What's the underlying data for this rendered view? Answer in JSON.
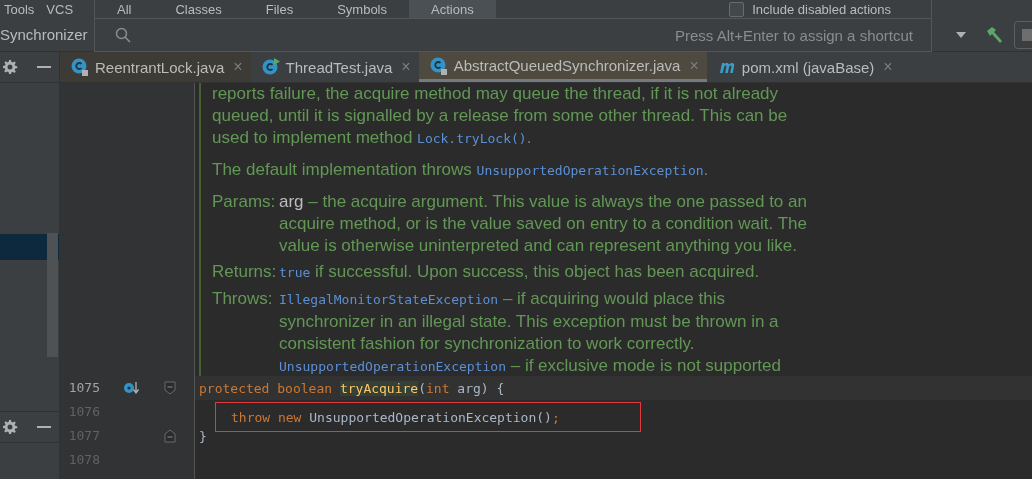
{
  "menu_bar": {
    "items": [
      "Tools",
      "VCS"
    ]
  },
  "navigation_bar": {
    "breadcrumbs": [
      "Synchronizer"
    ]
  },
  "search_popup": {
    "tabs": [
      {
        "label": "All",
        "selected": false
      },
      {
        "label": "Classes",
        "selected": false
      },
      {
        "label": "Files",
        "selected": false
      },
      {
        "label": "Symbols",
        "selected": false
      },
      {
        "label": "Actions",
        "selected": true
      }
    ],
    "include_disabled": {
      "label": "Include disabled actions",
      "checked": false
    },
    "hint": "Press Alt+Enter to assign a shortcut"
  },
  "editor_tabs": [
    {
      "label": "ReentrantLock.java",
      "kind": "class",
      "locked": true,
      "selected": false,
      "close": "×"
    },
    {
      "label": "ThreadTest.java",
      "kind": "runnable",
      "locked": false,
      "selected": false,
      "close": "×"
    },
    {
      "label": "AbstractQueuedSynchronizer.java",
      "kind": "class",
      "locked": true,
      "selected": true,
      "close": "×"
    },
    {
      "label": "pom.xml (javaBase)",
      "kind": "maven",
      "locked": false,
      "selected": false,
      "close": "×"
    }
  ],
  "editor": {
    "doc_comment": {
      "paragraphs": [
        [
          {
            "kind": "text",
            "text": "reports failure, the acquire method may queue the thread, if it is not already queued, until it is signalled by a release from some other thread. This can be used to implement method "
          },
          {
            "kind": "code",
            "text": "Lock.tryLock()"
          },
          {
            "kind": "text",
            "text": "."
          }
        ],
        [
          {
            "kind": "text",
            "text": "The default implementation throws "
          },
          {
            "kind": "code",
            "text": "UnsupportedOperationException"
          },
          {
            "kind": "text",
            "text": "."
          }
        ]
      ],
      "tags": [
        {
          "label": "Params:",
          "items": [
            [
              {
                "kind": "param",
                "text": "arg"
              },
              {
                "kind": "text",
                "text": " – the acquire argument. This value is always the one passed to an acquire method, or is the value saved on entry to a condition wait. The value is otherwise uninterpreted and can represent anything you like."
              }
            ]
          ]
        },
        {
          "label": "Returns:",
          "items": [
            [
              {
                "kind": "code",
                "text": "true"
              },
              {
                "kind": "text",
                "text": " if successful. Upon success, this object has been acquired."
              }
            ]
          ]
        },
        {
          "label": "Throws:",
          "items": [
            [
              {
                "kind": "code",
                "text": "IllegalMonitorStateException"
              },
              {
                "kind": "text",
                "text": " – if acquiring would place this synchronizer in an illegal state. This exception must be thrown in a consistent fashion for synchronization to work correctly."
              }
            ],
            [
              {
                "kind": "code",
                "text": "UnsupportedOperationException"
              },
              {
                "kind": "text",
                "text": " – if exclusive mode is not supported"
              }
            ]
          ]
        }
      ]
    },
    "lines": [
      {
        "number": "1075",
        "current": true,
        "override": true,
        "fold_start": true,
        "fold_end": false,
        "boxed": false,
        "tokens": [
          {
            "kind": "keyword",
            "text": "protected "
          },
          {
            "kind": "keyword",
            "text": "boolean "
          },
          {
            "kind": "method",
            "text": "tryAcquire"
          },
          {
            "kind": "plain",
            "text": "("
          },
          {
            "kind": "keyword",
            "text": "int "
          },
          {
            "kind": "plain",
            "text": "arg) {"
          }
        ]
      },
      {
        "number": "1076",
        "current": false,
        "override": false,
        "fold_start": false,
        "fold_end": false,
        "boxed": true,
        "tokens": [
          {
            "kind": "keyword",
            "text": "throw "
          },
          {
            "kind": "keyword",
            "text": "new "
          },
          {
            "kind": "plain",
            "text": "UnsupportedOperationException()"
          },
          {
            "kind": "keyword",
            "text": ";"
          }
        ]
      },
      {
        "number": "1077",
        "current": false,
        "override": false,
        "fold_start": false,
        "fold_end": true,
        "boxed": false,
        "tokens": [
          {
            "kind": "plain",
            "text": "}"
          }
        ]
      },
      {
        "number": "1078",
        "current": false,
        "override": false,
        "fold_start": false,
        "fold_end": false,
        "boxed": false
      }
    ]
  }
}
